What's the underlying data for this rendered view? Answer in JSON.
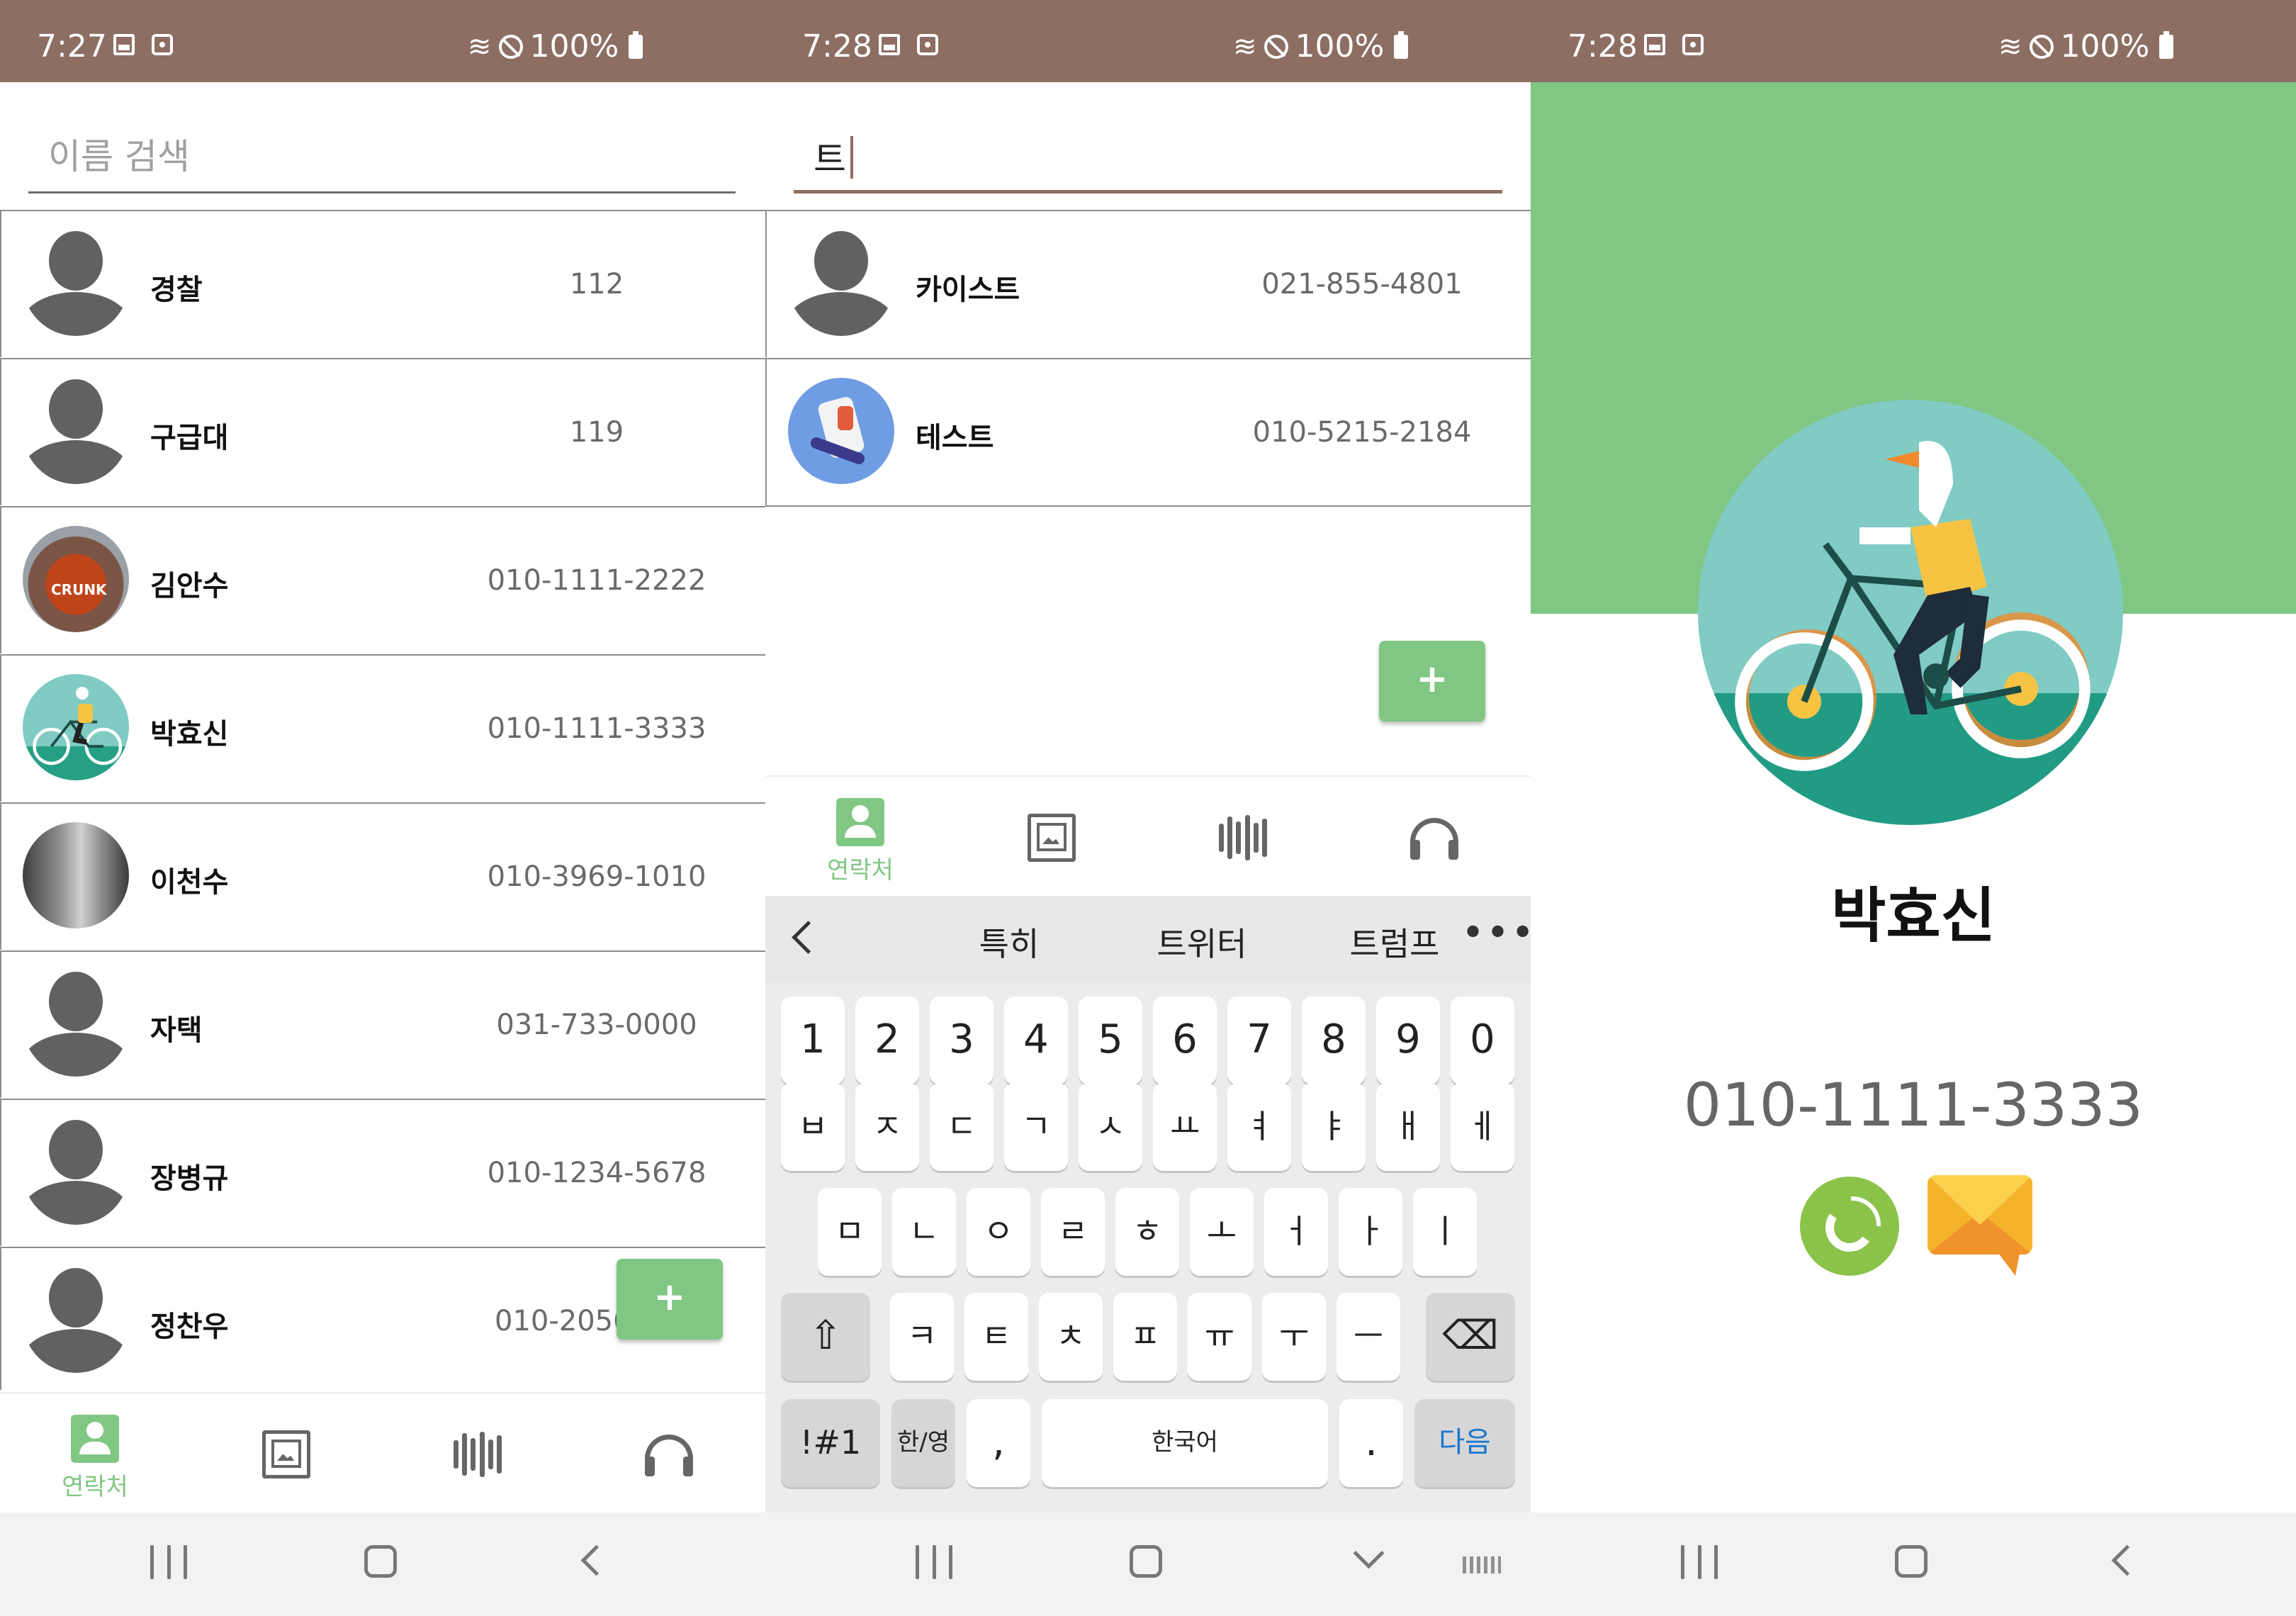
{
  "screen1": {
    "status": {
      "time": "7:27",
      "battery": "100%"
    },
    "search": {
      "placeholder": "이름 검색",
      "value": ""
    },
    "contacts": [
      {
        "name": "경찰",
        "phone": "112",
        "avatar": "default-avatar"
      },
      {
        "name": "구급대",
        "phone": "119",
        "avatar": "default-avatar"
      },
      {
        "name": "김안수",
        "phone": "010-1111-2222",
        "avatar": "photo",
        "avatar_text": "CRUNK"
      },
      {
        "name": "박효신",
        "phone": "010-1111-3333",
        "avatar": "bike-illustration"
      },
      {
        "name": "이천수",
        "phone": "010-3969-1010",
        "avatar": "photo"
      },
      {
        "name": "자택",
        "phone": "031-733-0000",
        "avatar": "default-avatar"
      },
      {
        "name": "장병규",
        "phone": "010-1234-5678",
        "avatar": "default-avatar"
      },
      {
        "name": "정찬우",
        "phone": "010-2056",
        "avatar": "default-avatar"
      }
    ],
    "fab": "+",
    "nav": {
      "contacts": "연락처"
    }
  },
  "screen2": {
    "status": {
      "time": "7:28",
      "battery": "100%"
    },
    "search": {
      "value": "트"
    },
    "contacts": [
      {
        "name": "카이스트",
        "phone": "021-855-4801",
        "avatar": "default-avatar"
      },
      {
        "name": "테스트",
        "phone": "010-5215-2184",
        "avatar": "illustration"
      }
    ],
    "fab": "+",
    "nav": {
      "contacts": "연락처"
    },
    "keyboard": {
      "suggestions": [
        "특히",
        "트위터",
        "트럼프"
      ],
      "more": "•••",
      "numbers": [
        "1",
        "2",
        "3",
        "4",
        "5",
        "6",
        "7",
        "8",
        "9",
        "0"
      ],
      "row1": [
        "ㅂ",
        "ㅈ",
        "ㄷ",
        "ㄱ",
        "ㅅ",
        "ㅛ",
        "ㅕ",
        "ㅑ",
        "ㅐ",
        "ㅔ"
      ],
      "row2": [
        "ㅁ",
        "ㄴ",
        "ㅇ",
        "ㄹ",
        "ㅎ",
        "ㅗ",
        "ㅓ",
        "ㅏ",
        "ㅣ"
      ],
      "row3": [
        "ㅋ",
        "ㅌ",
        "ㅊ",
        "ㅍ",
        "ㅠ",
        "ㅜ",
        "ㅡ"
      ],
      "shift": "⇧",
      "backspace": "⌫",
      "symbols": "!#1",
      "lang": "한/영",
      "comma": ",",
      "space": "한국어",
      "period": ".",
      "enter": "다음"
    }
  },
  "screen3": {
    "status": {
      "time": "7:28",
      "battery": "100%"
    },
    "name": "박효신",
    "phone": "010-1111-3333"
  },
  "colors": {
    "status_bar": "#8d6e63",
    "accent": "#81c784",
    "header_green": "#81c784"
  }
}
